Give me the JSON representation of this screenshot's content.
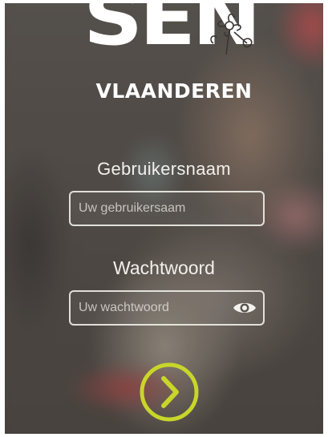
{
  "logo": {
    "wordmark": "SEN",
    "subtitle": "VLAANDEREN"
  },
  "login": {
    "username_label": "Gebruikersnaam",
    "username_placeholder": "Uw gebruikersaam",
    "password_label": "Wachtwoord",
    "password_placeholder": "Uw wachtwoord",
    "toggle_icon": "eye-icon",
    "submit_icon": "chevron-right-icon"
  },
  "colors": {
    "accent": "#c8d62a",
    "text": "#ffffff",
    "field_border": "#f0eee8"
  }
}
